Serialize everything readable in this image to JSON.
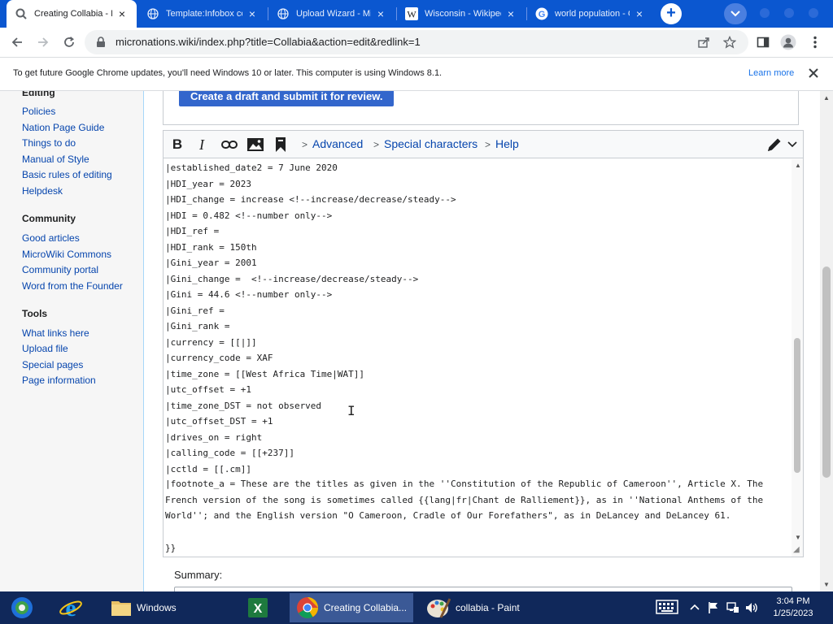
{
  "browser": {
    "tabs": [
      {
        "title": "Creating Collabia - Mi",
        "favicon": "google-chrome-search-icon",
        "active": true
      },
      {
        "title": "Template:Infobox cou",
        "favicon": "globe-icon",
        "active": false
      },
      {
        "title": "Upload Wizard - Micr",
        "favicon": "globe-icon",
        "active": false
      },
      {
        "title": "Wisconsin - Wikipedi",
        "favicon": "wikipedia-icon",
        "active": false
      },
      {
        "title": "world population - G",
        "favicon": "google-icon",
        "active": false
      }
    ],
    "address": "micronations.wiki/index.php?title=Collabia&action=edit&redlink=1",
    "infobar": {
      "message": "To get future Google Chrome updates, you'll need Windows 10 or later. This computer is using Windows 8.1.",
      "learn_more": "Learn more"
    }
  },
  "sidebar": {
    "sections": [
      {
        "heading": "Editing",
        "links": [
          "Policies",
          "Nation Page Guide",
          "Things to do",
          "Manual of Style",
          "Basic rules of editing",
          "Helpdesk"
        ]
      },
      {
        "heading": "Community",
        "links": [
          "Good articles",
          "MicroWiki Commons",
          "Community portal",
          "Word from the Founder"
        ]
      },
      {
        "heading": "Tools",
        "links": [
          "What links here",
          "Upload file",
          "Special pages",
          "Page information"
        ]
      }
    ]
  },
  "content": {
    "draft_button": "Create a draft and submit it for review.",
    "editor": {
      "menus": [
        "Advanced",
        "Special characters",
        "Help"
      ],
      "lines": [
        "|established_date2 = 7 June 2020",
        "|HDI_year = 2023",
        "|HDI_change = increase <!--increase/decrease/steady-->",
        "|HDI = 0.482 <!--number only-->",
        "|HDI_ref =",
        "|HDI_rank = 150th",
        "|Gini_year = 2001",
        "|Gini_change =  <!--increase/decrease/steady-->",
        "|Gini = 44.6 <!--number only-->",
        "|Gini_ref =",
        "|Gini_rank =",
        "|currency = [[|]]",
        "|currency_code = XAF",
        "|time_zone = [[West Africa Time|WAT]]",
        "|utc_offset = +1",
        "|time_zone_DST = not observed",
        "|utc_offset_DST = +1",
        "|drives_on = right",
        "|calling_code = [[+237]]",
        "|cctld = [[.cm]]"
      ],
      "footnote": "|footnote_a = These are the titles as given in the ''Constitution of the Republic of Cameroon'', Article X. The French version of the song is sometimes called {{lang|fr|Chant de Ralliement}}, as in ''National Anthems of the World''; and the English version \"O Cameroon, Cradle of Our Forefathers\", as in DeLancey and DeLancey 61.",
      "closing": "}}"
    },
    "summary_label": "Summary:"
  },
  "taskbar": {
    "items": [
      {
        "label": "",
        "icon": "media-center-icon"
      },
      {
        "label": "",
        "icon": "internet-explorer-icon"
      },
      {
        "label": "Windows",
        "icon": "folder-icon"
      },
      {
        "label": "",
        "icon": "excel-icon"
      },
      {
        "label": "Creating Collabia...",
        "icon": "chrome-icon"
      },
      {
        "label": "collabia - Paint",
        "icon": "paint-icon"
      }
    ],
    "clock": {
      "time": "3:04 PM",
      "date": "1/25/2023"
    }
  },
  "colors": {
    "chrome_tab_strip": "#0b57d0",
    "link": "#0645ad",
    "draft_button": "#3366cc",
    "taskbar": "#10285a"
  }
}
